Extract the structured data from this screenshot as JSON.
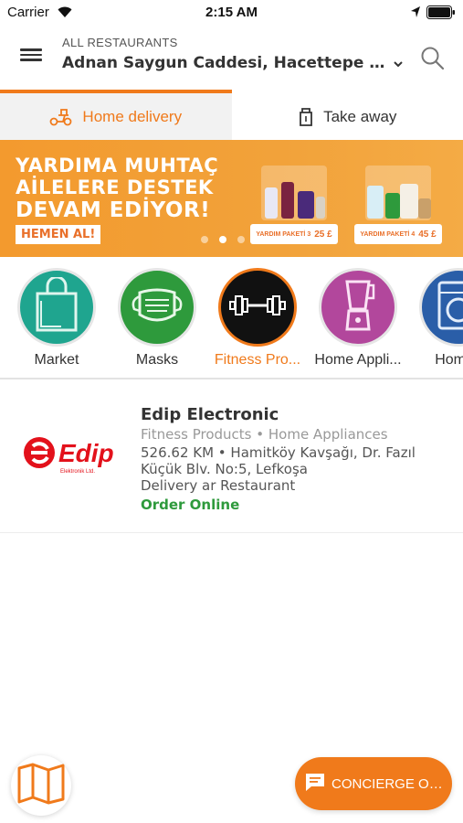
{
  "status_bar": {
    "carrier": "Carrier",
    "time": "2:15 AM"
  },
  "header": {
    "subtitle": "ALL RESTAURANTS",
    "address": "Adnan Saygun Caddesi, Hacettepe Mahalle"
  },
  "tabs": [
    {
      "label": "Home delivery",
      "icon": "scooter-icon",
      "active": true
    },
    {
      "label": "Take away",
      "icon": "bag-icon",
      "active": false
    }
  ],
  "banner": {
    "line1": "YARDIMA MUHTAÇ",
    "line2": "AİLELERE DESTEK",
    "line3": "DEVAM EDİYOR!",
    "cta": "HEMEN AL!",
    "packages": [
      {
        "label": "YARDIM PAKETİ 3",
        "price": "25 £"
      },
      {
        "label": "YARDIM PAKETİ 4",
        "price": "45 £"
      }
    ],
    "page_count": 4,
    "active_page": 2
  },
  "categories": [
    {
      "label": "Market",
      "icon": "shopping-bag-icon",
      "color": "#1fa58f",
      "active": false
    },
    {
      "label": "Masks",
      "icon": "face-mask-icon",
      "color": "#2e9a3c",
      "active": false
    },
    {
      "label": "Fitness Pro...",
      "icon": "dumbbell-icon",
      "color": "#111111",
      "active": true
    },
    {
      "label": "Home Appli...",
      "icon": "blender-icon",
      "color": "#b2479c",
      "active": false
    },
    {
      "label": "Home I",
      "icon": "washing-machine-icon",
      "color": "#2a5ea8",
      "active": false
    }
  ],
  "restaurant": {
    "name": "Edip Electronic",
    "categories": "Fitness Products • Home Appliances",
    "address": "526.62 KM • Hamitköy Kavşağı, Dr. Fazıl Küçük Blv. No:5, Lefkoşa",
    "delivery": "Delivery ar Restaurant",
    "order": "Order Online",
    "logo_text": "Edip",
    "logo_sub": "Elektronik Ltd."
  },
  "concierge": {
    "label": "CONCIERGE ORDER"
  },
  "colors": {
    "accent": "#f07a1b",
    "success": "#2e9a3c"
  }
}
